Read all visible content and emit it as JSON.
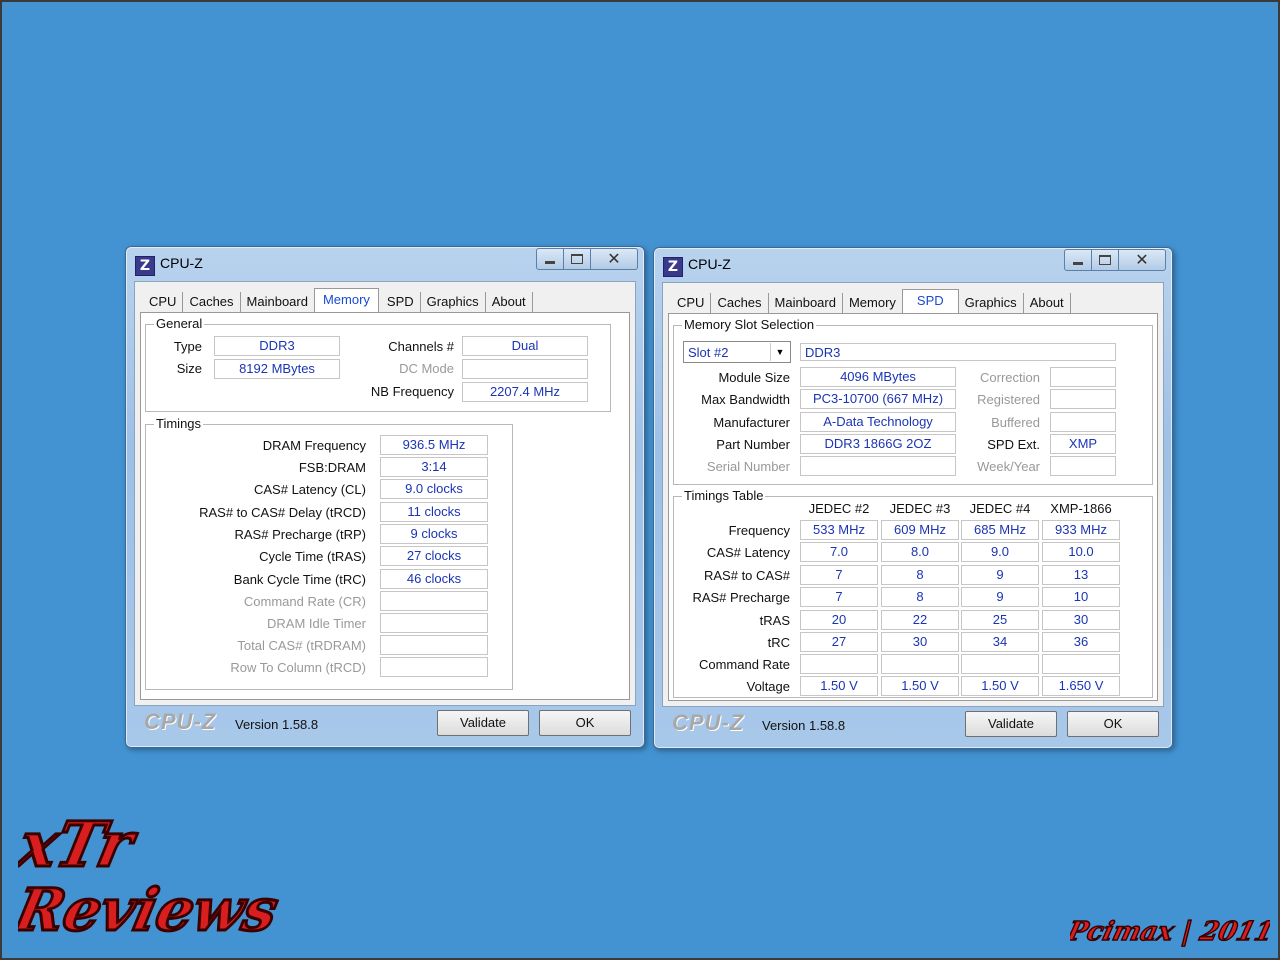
{
  "colors": {
    "desktop": "#4393d3",
    "value_text": "#1a35b4",
    "active_tab": "#1a4bd6",
    "logo_red": "#d81e1e"
  },
  "left_window": {
    "title": "CPU-Z",
    "icon_letter": "Z",
    "tabs": [
      "CPU",
      "Caches",
      "Mainboard",
      "Memory",
      "SPD",
      "Graphics",
      "About"
    ],
    "active_tab": "Memory",
    "general": {
      "label": "General",
      "type_label": "Type",
      "type_value": "DDR3",
      "size_label": "Size",
      "size_value": "8192 MBytes",
      "channels_label": "Channels #",
      "channels_value": "Dual",
      "dcmode_label": "DC Mode",
      "dcmode_value": "",
      "nbfreq_label": "NB Frequency",
      "nbfreq_value": "2207.4 MHz"
    },
    "timings": {
      "label": "Timings",
      "rows": [
        {
          "label": "DRAM Frequency",
          "value": "936.5 MHz",
          "enabled": true
        },
        {
          "label": "FSB:DRAM",
          "value": "3:14",
          "enabled": true
        },
        {
          "label": "CAS# Latency (CL)",
          "value": "9.0 clocks",
          "enabled": true
        },
        {
          "label": "RAS# to CAS# Delay (tRCD)",
          "value": "11 clocks",
          "enabled": true
        },
        {
          "label": "RAS# Precharge (tRP)",
          "value": "9 clocks",
          "enabled": true
        },
        {
          "label": "Cycle Time (tRAS)",
          "value": "27 clocks",
          "enabled": true
        },
        {
          "label": "Bank Cycle Time (tRC)",
          "value": "46 clocks",
          "enabled": true
        },
        {
          "label": "Command Rate (CR)",
          "value": "",
          "enabled": false
        },
        {
          "label": "DRAM Idle Timer",
          "value": "",
          "enabled": false
        },
        {
          "label": "Total CAS# (tRDRAM)",
          "value": "",
          "enabled": false
        },
        {
          "label": "Row To Column (tRCD)",
          "value": "",
          "enabled": false
        }
      ]
    },
    "footer": {
      "brand": "CPU-Z",
      "version": "Version 1.58.8",
      "validate": "Validate",
      "ok": "OK"
    }
  },
  "right_window": {
    "title": "CPU-Z",
    "icon_letter": "Z",
    "tabs": [
      "CPU",
      "Caches",
      "Mainboard",
      "Memory",
      "SPD",
      "Graphics",
      "About"
    ],
    "active_tab": "SPD",
    "slot": {
      "label": "Memory Slot Selection",
      "selected": "Slot #2",
      "type_value": "DDR3",
      "module_size_label": "Module Size",
      "module_size": "4096 MBytes",
      "max_bw_label": "Max Bandwidth",
      "max_bw": "PC3-10700 (667 MHz)",
      "manufacturer_label": "Manufacturer",
      "manufacturer": "A-Data Technology",
      "part_label": "Part Number",
      "part": "DDR3 1866G 2OZ",
      "serial_label": "Serial Number",
      "serial": "",
      "correction_label": "Correction",
      "correction": "",
      "registered_label": "Registered",
      "registered": "",
      "buffered_label": "Buffered",
      "buffered": "",
      "spdext_label": "SPD Ext.",
      "spdext": "XMP",
      "weekyear_label": "Week/Year",
      "weekyear": ""
    },
    "timings_table": {
      "label": "Timings Table",
      "columns": [
        "JEDEC #2",
        "JEDEC #3",
        "JEDEC #4",
        "XMP-1866"
      ],
      "rows": [
        {
          "label": "Frequency",
          "values": [
            "533 MHz",
            "609 MHz",
            "685 MHz",
            "933 MHz"
          ]
        },
        {
          "label": "CAS# Latency",
          "values": [
            "7.0",
            "8.0",
            "9.0",
            "10.0"
          ]
        },
        {
          "label": "RAS# to CAS#",
          "values": [
            "7",
            "8",
            "9",
            "13"
          ]
        },
        {
          "label": "RAS# Precharge",
          "values": [
            "7",
            "8",
            "9",
            "10"
          ]
        },
        {
          "label": "tRAS",
          "values": [
            "20",
            "22",
            "25",
            "30"
          ]
        },
        {
          "label": "tRC",
          "values": [
            "27",
            "30",
            "34",
            "36"
          ]
        },
        {
          "label": "Command Rate",
          "values": [
            "",
            "",
            "",
            ""
          ]
        },
        {
          "label": "Voltage",
          "values": [
            "1.50 V",
            "1.50 V",
            "1.50 V",
            "1.650 V"
          ]
        }
      ]
    },
    "footer": {
      "brand": "CPU-Z",
      "version": "Version 1.58.8",
      "validate": "Validate",
      "ok": "OK"
    }
  },
  "watermarks": {
    "logo_line1": "xTr",
    "logo_line2": "Reviews",
    "signature": "Pcimax | 2011"
  }
}
